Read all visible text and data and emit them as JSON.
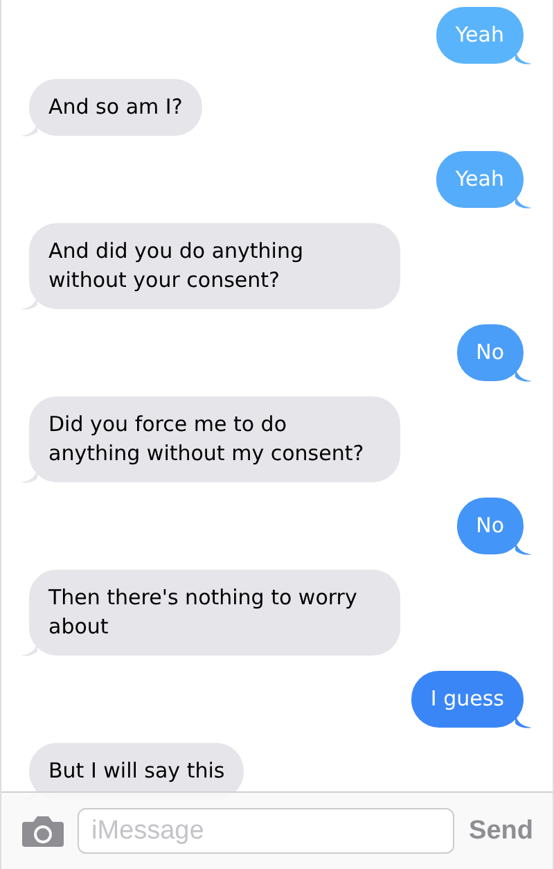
{
  "messages": [
    {
      "kind": "sent",
      "text": "Yeah",
      "color": "#5ab4fb"
    },
    {
      "kind": "received",
      "text": "And so am I?"
    },
    {
      "kind": "sent",
      "text": "Yeah",
      "color": "#55acfa"
    },
    {
      "kind": "received",
      "text": "And did you do anything without your consent?"
    },
    {
      "kind": "sent",
      "text": "No",
      "color": "#4b9ef8"
    },
    {
      "kind": "received",
      "text": "Did you force me to do anything without my consent?"
    },
    {
      "kind": "sent",
      "text": "No",
      "color": "#4395f8"
    },
    {
      "kind": "received",
      "text": "Then there's nothing to worry about"
    },
    {
      "kind": "sent",
      "text": "I guess",
      "color": "#3a86f7"
    },
    {
      "kind": "received",
      "text": "But I will say this"
    }
  ],
  "compose": {
    "placeholder": "iMessage",
    "send": "Send"
  }
}
